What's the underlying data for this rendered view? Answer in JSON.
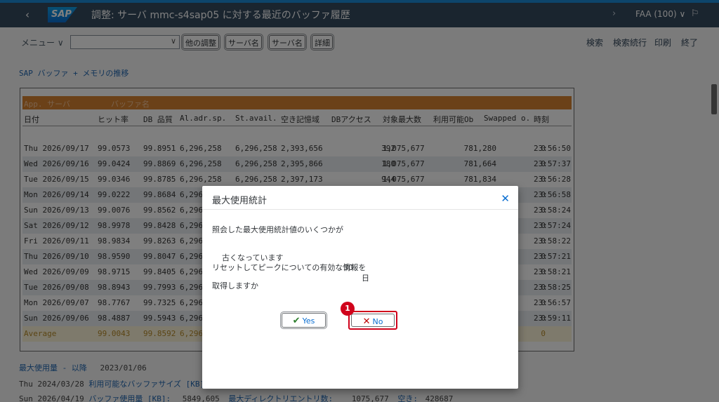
{
  "shell": {
    "back_icon": "‹",
    "logo": "SAP",
    "title": "調整: サーバ mmc-s4sap05 に対する最近のバッファ履歴",
    "next_icon": "›",
    "system": "FAA (100) ∨",
    "flag_icon": "⚐"
  },
  "toolbar": {
    "menu": "メニュー ∨",
    "combo_value": "",
    "combo_arrow": "∨",
    "buttons": [
      "他の調整",
      "サーバ名",
      "サーバ名",
      "詳細"
    ],
    "links": [
      "検索",
      "検索続行",
      "印刷",
      "終了"
    ]
  },
  "section_title": "SAP バッファ + メモリの推移",
  "report": {
    "header1": [
      "App. サーバ",
      "バッファ名"
    ],
    "header2": [
      "日付",
      "ヒット率",
      "DB 品質",
      "Al.adr.sp.",
      "St.avail.",
      "空き記憶域",
      "DBアクセス",
      "対象最大数",
      "利用可能Ob",
      "Swapped o.",
      "時刻"
    ],
    "rows": [
      [
        "Thu 2026/09/17",
        "99.0573",
        "99.8951",
        "6,296,258",
        "6,296,258",
        "2,393,656",
        "392",
        "1,075,677",
        "781,280",
        "0",
        "23:56:50"
      ],
      [
        "Wed 2026/09/16",
        "99.0424",
        "99.8869",
        "6,296,258",
        "6,296,258",
        "2,395,866",
        "180",
        "1,075,677",
        "781,664",
        "0",
        "23:57:37"
      ],
      [
        "Tue 2026/09/15",
        "99.0346",
        "99.8785",
        "6,296,258",
        "6,296,258",
        "2,397,173",
        "944",
        "1,075,677",
        "781,834",
        "0",
        "23:56:28"
      ],
      [
        "Mon 2026/09/14",
        "99.0222",
        "99.8684",
        "6,296",
        "",
        "",
        "",
        "",
        "",
        "0",
        "23:56:58"
      ],
      [
        "Sun 2026/09/13",
        "99.0076",
        "99.8562",
        "6,296",
        "",
        "",
        "",
        "",
        "",
        "0",
        "23:58:24"
      ],
      [
        "Sat 2026/09/12",
        "98.9978",
        "99.8428",
        "6,296",
        "",
        "",
        "",
        "",
        "",
        "0",
        "23:57:24"
      ],
      [
        "Fri 2026/09/11",
        "98.9834",
        "99.8263",
        "6,296",
        "",
        "",
        "",
        "",
        "",
        "0",
        "23:58:22"
      ],
      [
        "Thu 2026/09/10",
        "98.9590",
        "99.8047",
        "6,296",
        "",
        "",
        "",
        "",
        "",
        "0",
        "23:57:21"
      ],
      [
        "Wed 2026/09/09",
        "98.9715",
        "99.8405",
        "6,296",
        "",
        "",
        "",
        "",
        "",
        "0",
        "23:58:21"
      ],
      [
        "Tue 2026/09/08",
        "98.8943",
        "99.7993",
        "6,296",
        "",
        "",
        "",
        "",
        "",
        "0",
        "23:58:25"
      ],
      [
        "Mon 2026/09/07",
        "98.7767",
        "99.7325",
        "6,296",
        "",
        "",
        "",
        "",
        "",
        "0",
        "23:56:57"
      ],
      [
        "Sun 2026/09/06",
        "98.4887",
        "99.5943",
        "6,296",
        "",
        "",
        "",
        "",
        "",
        "0",
        "23:59:11"
      ]
    ],
    "average": [
      "Average",
      "99.0043",
      "99.8592",
      "6,296",
      "",
      "",
      "",
      "",
      "",
      "0",
      ""
    ]
  },
  "footer": {
    "line1_label": "最大使用量 - 以降",
    "line1_value": "2023/01/06",
    "line2_date": "Thu 2024/03/28",
    "line2_label": "利用可能なバッファサイズ [KB]",
    "line3_date": "Sun 2026/04/19",
    "line3_label": "バッファ使用量 [KB]:",
    "line3_value": "5849,605",
    "line3_label2": "最大ディレクトリエントリ数:",
    "line3_value2": "1075,677",
    "line3_label3": "空き:",
    "line3_value3": "428687"
  },
  "dialog": {
    "title": "最大使用統計",
    "close_icon": "✕",
    "line1": "照会した最大使用統計値のいくつかが",
    "line2_text": "古くなっています",
    "line2_value": "30",
    "line2_unit": "日",
    "line3": "リセットしてピークについての有効な情報を",
    "line4": "取得しますか",
    "yes_icon": "✔",
    "yes_label": "Yes",
    "no_icon": "✕",
    "no_label": "No",
    "badge": "1"
  }
}
